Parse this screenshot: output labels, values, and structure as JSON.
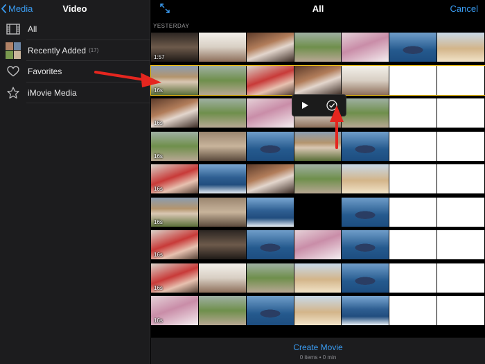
{
  "left_panel": {
    "back_label": "Media",
    "title": "Video",
    "items": [
      {
        "label": "All",
        "icon": "film-strip-icon",
        "count": ""
      },
      {
        "label": "Recently Added",
        "icon": "recent-thumbnail-icon",
        "count": "(17)"
      },
      {
        "label": "Favorites",
        "icon": "heart-icon",
        "count": ""
      },
      {
        "label": "iMovie Media",
        "icon": "star-icon",
        "count": ""
      }
    ]
  },
  "right_panel": {
    "title": "All",
    "cancel_label": "Cancel",
    "section_label": "YESTERDAY",
    "durations": {
      "r0": "1:57",
      "r1": "16s",
      "r2": "16s",
      "r3": "16s",
      "r4": "16s",
      "r5": "16s",
      "r6": "16s",
      "r7": "16s",
      "r8": "16s"
    }
  },
  "bottom_bar": {
    "create_label": "Create Movie",
    "sub_label": "0 items • 0 min"
  },
  "colors": {
    "accent": "#3a9cf2",
    "selection": "#f5c518",
    "annotation": "#e5261f",
    "panel_bg": "#1c1c1e"
  }
}
